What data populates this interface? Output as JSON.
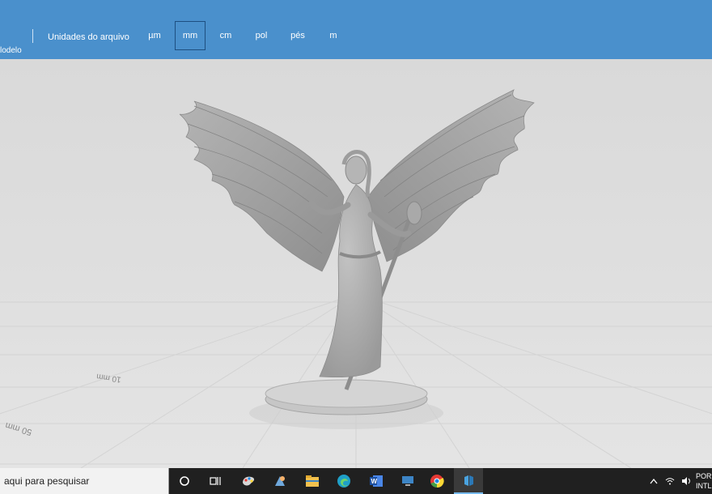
{
  "ribbon": {
    "left_label": "lodelo",
    "units_label": "Unidades do arquivo",
    "units": [
      {
        "label": "µm",
        "selected": false
      },
      {
        "label": "mm",
        "selected": true
      },
      {
        "label": "cm",
        "selected": false
      },
      {
        "label": "pol",
        "selected": false
      },
      {
        "label": "pés",
        "selected": false
      },
      {
        "label": "m",
        "selected": false
      }
    ]
  },
  "viewport": {
    "floor_labels": [
      "50 mm",
      "10 mm"
    ]
  },
  "taskbar": {
    "search_placeholder": "aqui para pesquisar",
    "icons": [
      "cortana-circle-icon",
      "task-view-icon",
      "paint-icon",
      "paint3d-icon",
      "file-explorer-icon",
      "edge-icon",
      "word-icon",
      "remote-desktop-icon",
      "chrome-icon",
      "3d-viewer-icon"
    ],
    "tray": {
      "lang_line1": "POR",
      "lang_line2": "INTL"
    }
  }
}
